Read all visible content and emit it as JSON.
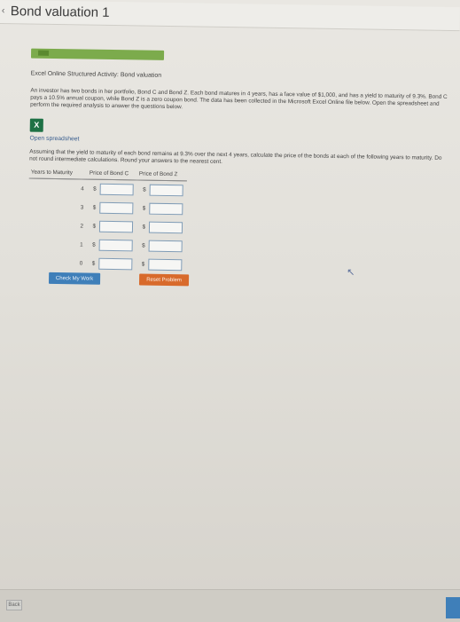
{
  "header": {
    "title": "Bond valuation 1"
  },
  "activity": {
    "title": "Excel Online Structured Activity: Bond valuation",
    "intro": "An investor has two bonds in her portfolio, Bond C and Bond Z. Each bond matures in 4 years, has a face value of $1,000, and has a yield to maturity of 9.3%. Bond C pays a 10.5% annual coupon, while Bond Z is a zero coupon bond. The data has been collected in the Microsoft Excel Online file below. Open the spreadsheet and perform the required analysis to answer the questions below.",
    "open_link": "Open spreadsheet",
    "instructions": "Assuming that the yield to maturity of each bond remains at 9.3% over the next 4 years, calculate the price of the bonds at each of the following years to maturity. Do not round intermediate calculations. Round your answers to the nearest cent."
  },
  "excel_icon": {
    "icon": "excel-icon",
    "letter": "X",
    "color": "#1e7145"
  },
  "table": {
    "headers": [
      "Years to Maturity",
      "Price of Bond C",
      "Price of Bond Z"
    ],
    "currency": "$",
    "rows": [
      {
        "years": "4",
        "bond_c": "",
        "bond_z": ""
      },
      {
        "years": "3",
        "bond_c": "",
        "bond_z": ""
      },
      {
        "years": "2",
        "bond_c": "",
        "bond_z": ""
      },
      {
        "years": "1",
        "bond_c": "",
        "bond_z": ""
      },
      {
        "years": "0",
        "bond_c": "",
        "bond_z": ""
      }
    ]
  },
  "buttons": {
    "check": "Check My Work",
    "reset": "Reset Problem",
    "back": "Back"
  },
  "colors": {
    "accent_green": "#7cab4c",
    "check_blue": "#3f7fb9",
    "reset_orange": "#d86a2b"
  }
}
